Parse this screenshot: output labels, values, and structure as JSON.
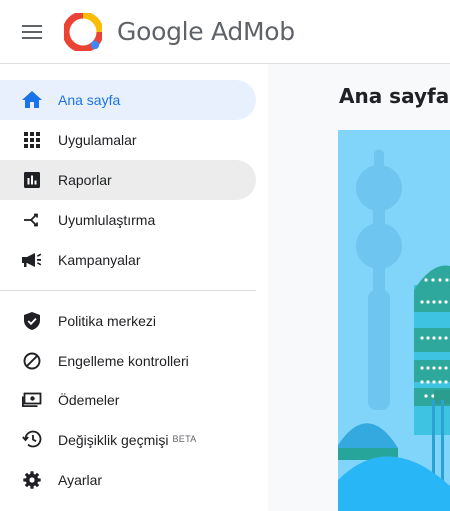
{
  "app": {
    "brand": "Google AdMob"
  },
  "sidebar": {
    "items": [
      {
        "label": "Ana sayfa",
        "icon": "home-icon"
      },
      {
        "label": "Uygulamalar",
        "icon": "apps-grid-icon"
      },
      {
        "label": "Raporlar",
        "icon": "reports-chart-icon"
      },
      {
        "label": "Uyumlulaştırma",
        "icon": "mediation-merge-icon"
      },
      {
        "label": "Kampanyalar",
        "icon": "campaign-megaphone-icon"
      },
      {
        "label": "Politika merkezi",
        "icon": "policy-shield-icon"
      },
      {
        "label": "Engelleme kontrolleri",
        "icon": "blocking-icon"
      },
      {
        "label": "Ödemeler",
        "icon": "payments-icon"
      },
      {
        "label": "Değişiklik geçmişi",
        "icon": "history-icon",
        "badge": "BETA"
      },
      {
        "label": "Ayarlar",
        "icon": "settings-gear-icon"
      }
    ]
  },
  "main": {
    "title": "Ana sayfa"
  },
  "colors": {
    "accent": "#1a73e8",
    "active_bg": "#e8f0fe",
    "hover_bg": "#ececec",
    "icon": "#202124",
    "sky": "#81d4fa",
    "teal": "#26a69a"
  }
}
